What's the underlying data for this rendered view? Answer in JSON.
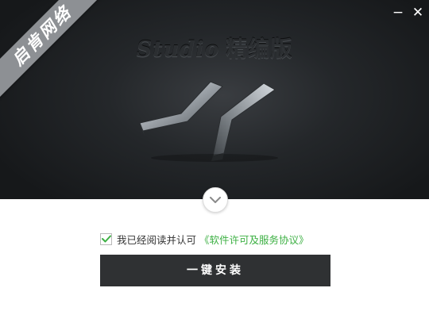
{
  "app": {
    "product_title": "Studio",
    "product_edition": "精编版",
    "ribbon_text": "启肯网络"
  },
  "window_controls": {
    "minimize_label": "−",
    "close_label": "✕"
  },
  "expand": {
    "icon": "chevron-down-icon"
  },
  "agreement": {
    "checked": true,
    "text": "我已经阅读并认可",
    "link": "《软件许可及服务协议》"
  },
  "install_button": {
    "label": "一键安装"
  },
  "colors": {
    "hero_bg": "#24272a",
    "link_green": "#3cb043",
    "check_green": "#3cb043",
    "button_bg": "#2f3133",
    "ribbon_bg": "#8d9094"
  }
}
